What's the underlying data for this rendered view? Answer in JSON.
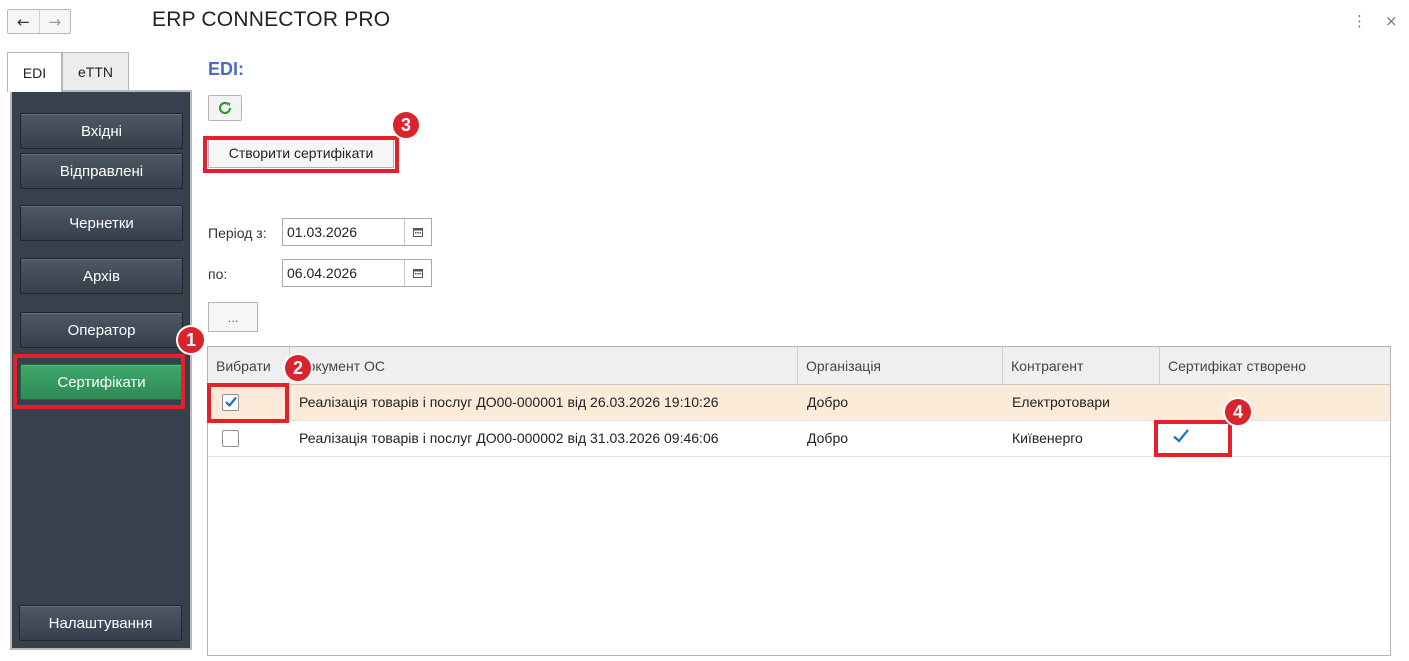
{
  "app": {
    "title": "ERP CONNECTOR PRO",
    "more_icon": "⋮",
    "close_icon": "×"
  },
  "nav": {
    "back": "←",
    "forward": "→"
  },
  "tabs": [
    {
      "label": "EDI",
      "active": true
    },
    {
      "label": "eTTN",
      "active": false
    }
  ],
  "sidebar": {
    "items": [
      {
        "label": "Вхідні"
      },
      {
        "label": "Відправлені"
      },
      {
        "label": "Чернетки"
      },
      {
        "label": "Архів"
      },
      {
        "label": "Оператор"
      },
      {
        "label": "Сертифікати",
        "active": true
      }
    ],
    "settings_label": "Налаштування"
  },
  "main": {
    "section_title": "EDI:",
    "create_button": "Створити сертифікати",
    "period_from_label": "Період з:",
    "period_from_value": "01.03.2026",
    "period_to_label": "по:",
    "period_to_value": "06.04.2026",
    "more_button": "..."
  },
  "table": {
    "columns": [
      "Вибрати",
      "Документ ОС",
      "Організація",
      "Контрагент",
      "Сертифікат створено"
    ],
    "rows": [
      {
        "selected": true,
        "document": "Реалізація товарів і послуг ДО00-000001 від 26.03.2026 19:10:26",
        "organization": "Добро",
        "counterparty": "Електротовари",
        "certificate_created": false
      },
      {
        "selected": false,
        "document": "Реалізація товарів і послуг ДО00-000002 від 31.03.2026 09:46:06",
        "organization": "Добро",
        "counterparty": "Київенерго",
        "certificate_created": true
      }
    ]
  },
  "annotations": [
    "1",
    "2",
    "3",
    "4"
  ],
  "colors": {
    "sidebar_bg": "#37414c",
    "active_item": "#3fa86a",
    "accent_title": "#4a6ac4",
    "callout_red": "#e5202a",
    "selected_row": "#fcebd9",
    "check_blue": "#1a73c9"
  }
}
